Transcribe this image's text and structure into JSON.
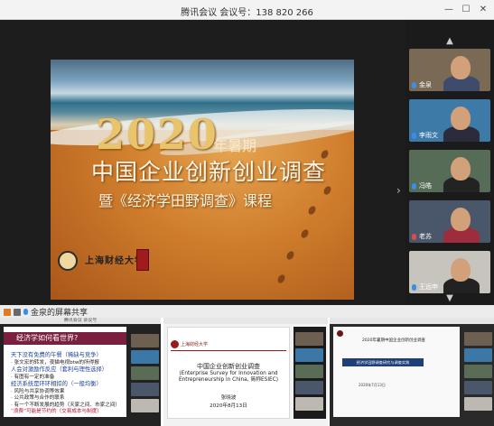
{
  "window": {
    "title": "腾讯会议  会议号：138 820 266",
    "min_glyph": "—",
    "max_glyph": "☐",
    "close_glyph": "✕"
  },
  "slide": {
    "year": "2020",
    "season": "年暑期",
    "headline": "中国企业创新创业调查",
    "subline": "暨《经济学田野调查》课程",
    "university": "上海财经大学"
  },
  "stage": {
    "next_arrow": "›"
  },
  "participants": [
    {
      "name": "金泉",
      "muted": false,
      "shirt": "#3f4b6a",
      "bg": "#7a6a55"
    },
    {
      "name": "李雨文",
      "muted": false,
      "shirt": "#2b2b3b",
      "bg": "#3d7aa8"
    },
    {
      "name": "冯皓",
      "muted": false,
      "shirt": "#232323",
      "bg": "#566c57"
    },
    {
      "name": "老苏",
      "muted": true,
      "shirt": "#9d2d3d",
      "bg": "#4a5669"
    },
    {
      "name": "王远申",
      "muted": false,
      "shirt": "#222222",
      "bg": "#c7c3bd"
    }
  ],
  "sidebar": {
    "up_glyph": "▲",
    "down_glyph": "▼"
  },
  "share_banner": {
    "text": "金泉的屏幕共享"
  },
  "thumb1": {
    "title_bar": "腾讯会议 会议号",
    "heading": "经济学如何看世界?",
    "lines": [
      {
        "text": "天下没有免费的午餐（稀缺与竞争）",
        "style": "blue"
      },
      {
        "text": "· 张文宏的转发，夜猫电视btw的所得报",
        "style": "normal"
      },
      {
        "text": "人会对激励作反应（套利与理性选择）",
        "style": "blue"
      },
      {
        "text": "· 有图有一定的准备",
        "style": "normal"
      },
      {
        "text": "经济系统是环环相扣的（一般均衡）",
        "style": "blue"
      },
      {
        "text": "· 风险与共享协调等效果",
        "style": "normal"
      },
      {
        "text": "· 公共政策与合作的联系",
        "style": "normal"
      },
      {
        "text": "· 有一个不断发展的趋势（天家之间、市家之间）",
        "style": "normal"
      },
      {
        "text": "“浪费”可能是节约的（交易成本与制度）",
        "style": "red"
      }
    ]
  },
  "thumb2": {
    "university": "上海财经大学",
    "title": "中国企业创新创业调查",
    "english": "(Enterprise Survey for Innovation and Entrepreneurship in China, 简称ESIEC)",
    "author": "张晓波",
    "date": "2020年8月13日"
  },
  "thumb3": {
    "heading": "2020年暑期中国企业创新创业调查",
    "band": "经济学田野调查研究与调查实践",
    "date": "2020年7月13日"
  }
}
